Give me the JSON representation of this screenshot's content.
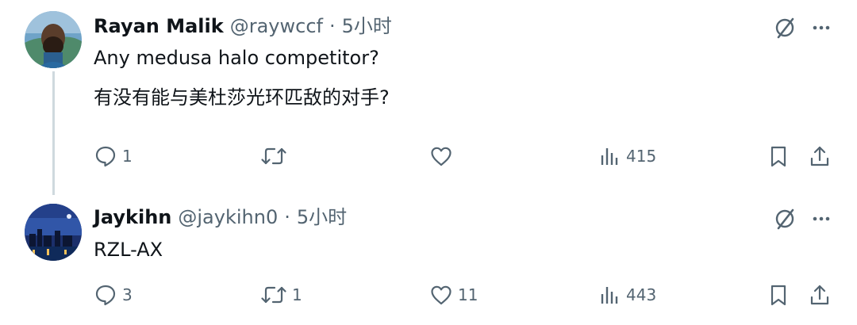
{
  "posts": [
    {
      "author": "Rayan Malik",
      "handle": "@raywccf",
      "separator": "·",
      "time": "5小时",
      "text_lines": [
        "Any medusa halo competitor?",
        "有没有能与美杜莎光环匹敌的对手?"
      ],
      "avatar_icon": "avatar-bearded-man",
      "stats": {
        "replies": "1",
        "reposts": "",
        "likes": "",
        "views": "415"
      }
    },
    {
      "author": "Jaykihn",
      "handle": "@jaykihn0",
      "separator": "·",
      "time": "5小时",
      "text_lines": [
        "RZL-AX"
      ],
      "avatar_icon": "avatar-night-city",
      "stats": {
        "replies": "3",
        "reposts": "1",
        "likes": "11",
        "views": "443"
      }
    }
  ],
  "icons": {
    "top": [
      "grok-icon",
      "more-icon"
    ],
    "actions": [
      "reply-icon",
      "repost-icon",
      "like-icon",
      "views-icon",
      "bookmark-icon",
      "share-icon"
    ]
  },
  "colors": {
    "text": "#0f1419",
    "secondary": "#536471",
    "thread_line": "#cfd9de",
    "background": "#ffffff"
  }
}
